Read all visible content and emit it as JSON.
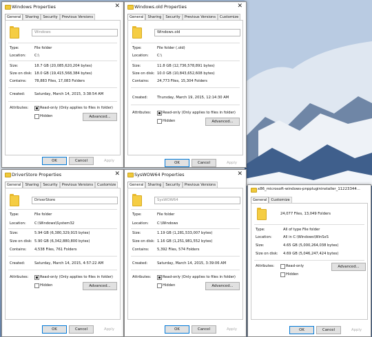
{
  "tabs_common": {
    "general": "General",
    "sharing": "Sharing",
    "security": "Security",
    "previous_versions": "Previous Versions",
    "customize": "Customize"
  },
  "labels": {
    "type": "Type:",
    "location": "Location:",
    "size": "Size:",
    "size_on_disk": "Size on disk:",
    "contains": "Contains:",
    "created": "Created:",
    "attributes": "Attributes:",
    "readonly": "Read-only (Only applies to files in folder)",
    "readonly_short": "Read-only",
    "hidden": "Hidden",
    "advanced": "Advanced...",
    "ok": "OK",
    "cancel": "Cancel",
    "apply": "Apply"
  },
  "win1": {
    "title": "Windows Properties",
    "name": "Windows",
    "type": "File folder",
    "location": "C:\\",
    "size": "18.7 GB (20,085,620,204 bytes)",
    "size_on_disk": "18.0 GB (19,415,568,384 bytes)",
    "contains": "78,883 Files, 17,083 Folders",
    "created": "Saturday, March 14, 2015, 3:38:54 AM"
  },
  "win2": {
    "title": "Windows.old Properties",
    "name": "Windows.old",
    "type": "File folder (.old)",
    "location": "C:\\",
    "size": "11.8 GB (12,736,578,891 bytes)",
    "size_on_disk": "10.0 GB (10,843,652,608 bytes)",
    "contains": "24,773 Files, 15,304 Folders",
    "created": "Thursday, March 19, 2015, 12:14:30 AM"
  },
  "win3": {
    "title": "DriverStore Properties",
    "name": "DriverStore",
    "type": "File folder",
    "location": "C:\\Windows\\System32",
    "size": "5.94 GB (6,380,329,915 bytes)",
    "size_on_disk": "5.90 GB (6,342,880,800 bytes)",
    "contains": "4,538 Files, 761 Folders",
    "created": "Saturday, March 14, 2015, 4:57:22 AM"
  },
  "win4": {
    "title": "SysWOW64 Properties",
    "name": "SysWOW64",
    "type": "File folder",
    "location": "C:\\Windows",
    "size": "1.19 GB (1,281,533,007 bytes)",
    "size_on_disk": "1.16 GB (1,251,981,552 bytes)",
    "contains": "5,392 Files, 574 Folders",
    "created": "Saturday, March 14, 2015, 3:39:06 AM"
  },
  "win5": {
    "title": "x86_microsoft-windows-pnpplugininstaller_11223344...",
    "summary": "24,077 Files, 13,049 Folders",
    "type": "All of type File folder",
    "location": "All in C:\\Windows\\WinSxS",
    "size": "4.65 GB (5,000,264,038 bytes)",
    "size_on_disk": "4.69 GB (5,046,247,424 bytes)"
  },
  "colors": {
    "folder": "#f5cd43",
    "accent": "#0078d7"
  }
}
